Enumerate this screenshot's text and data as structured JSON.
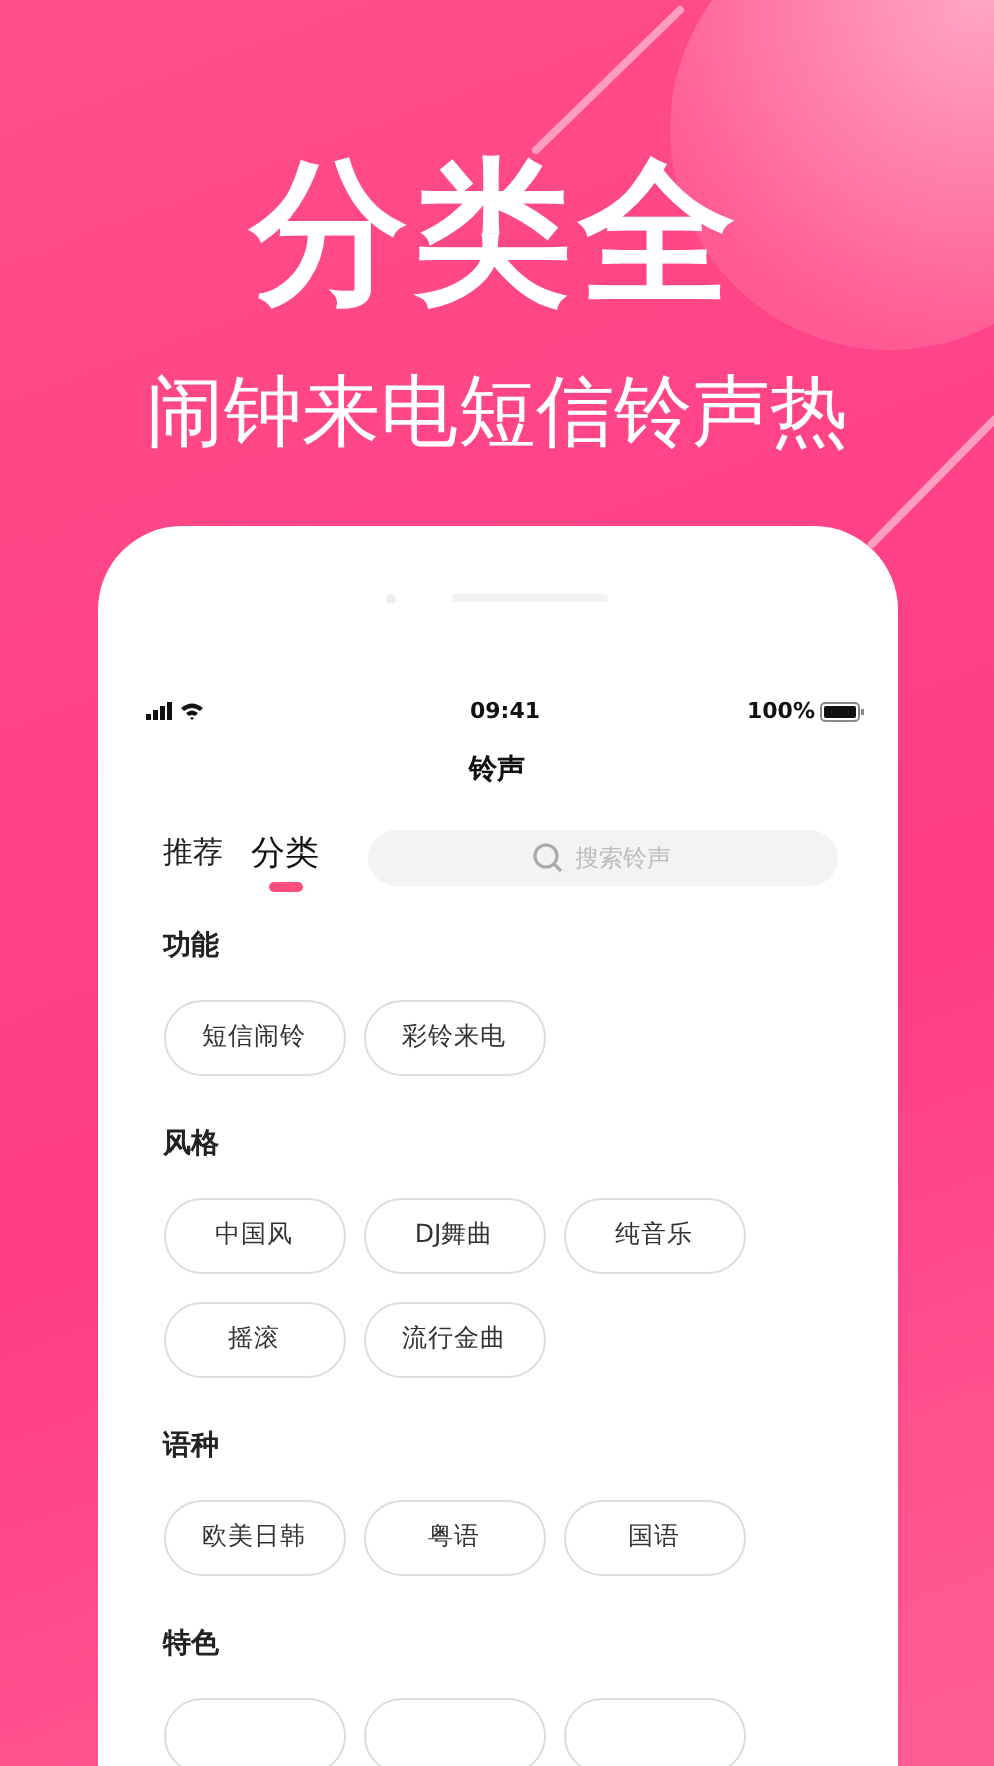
{
  "headline": "分类全",
  "subtitle": "闹钟来电短信铃声热",
  "phone": {
    "status_bar": {
      "time": "09:41",
      "battery": "100%"
    },
    "title": "铃声",
    "tabs": [
      {
        "label": "推荐",
        "selected": false
      },
      {
        "label": "分类",
        "selected": true
      }
    ],
    "search": {
      "placeholder": "搜索铃声"
    },
    "sections": [
      {
        "title": "功能",
        "tags": [
          {
            "kind": "text",
            "label": "短信闹铃"
          },
          {
            "kind": "text",
            "label": "彩铃来电"
          }
        ]
      },
      {
        "title": "风格",
        "tags": [
          {
            "kind": "text",
            "label": "中国风"
          },
          {
            "kind": "text",
            "label": "DJ舞曲"
          },
          {
            "kind": "text",
            "label": "纯音乐"
          },
          {
            "kind": "text",
            "label": "摇滚"
          },
          {
            "kind": "text",
            "label": "流行金曲"
          }
        ]
      },
      {
        "title": "语种",
        "tags": [
          {
            "kind": "text",
            "label": "欧美日韩"
          },
          {
            "kind": "text",
            "label": "粤语"
          },
          {
            "kind": "text",
            "label": "国语"
          }
        ]
      },
      {
        "title": "特色",
        "tags": [
          {
            "kind": "cut"
          },
          {
            "kind": "cut"
          },
          {
            "kind": "cut"
          }
        ]
      }
    ]
  }
}
